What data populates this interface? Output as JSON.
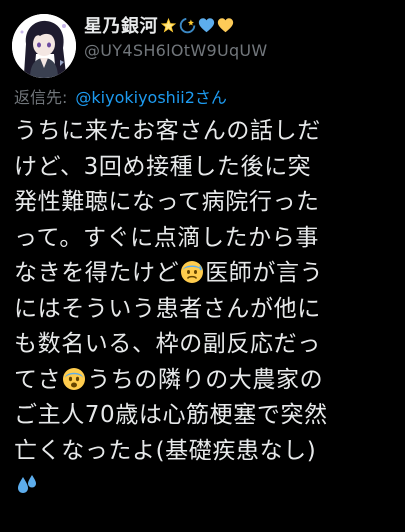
{
  "tweet": {
    "author": {
      "display_name": "星乃銀河",
      "name_emojis": [
        "star-glow-emoji",
        "dizzy-emoji",
        "blue-heart-emoji",
        "yellow-heart-emoji"
      ],
      "handle": "@UY4SH6lOtW9UqUW",
      "avatar": "anime-avatar"
    },
    "reply": {
      "prefix": "返信先:",
      "target": "@kiyokiyoshii2さん"
    },
    "body_lines": [
      {
        "text": "うちに来たお客さんの話しだ"
      },
      {
        "text": "けど、3回め接種した後に突"
      },
      {
        "text": "発性難聴になって病院行った"
      },
      {
        "text": "って。すぐに点滴したから事"
      },
      {
        "before": "なきを得たけど",
        "emoji": "anxious-sweat-face-emoji",
        "after": "医師が言う"
      },
      {
        "text": "にはそういう患者さんが他に"
      },
      {
        "text": "も数名いる、枠の副反応だっ"
      },
      {
        "before": "てさ",
        "emoji": "fearful-face-emoji",
        "after": "うちの隣りの大農家の"
      },
      {
        "text": "ご主人70歳は心筋梗塞で突然"
      },
      {
        "text": "亡くなったよ(基礎疾患なし)"
      },
      {
        "before": "",
        "emoji": "sweat-droplets-emoji",
        "after": ""
      }
    ],
    "colors": {
      "background": "#000000",
      "text": "#e7e9ea",
      "secondary": "#71767b",
      "link": "#1d9bf0"
    }
  }
}
